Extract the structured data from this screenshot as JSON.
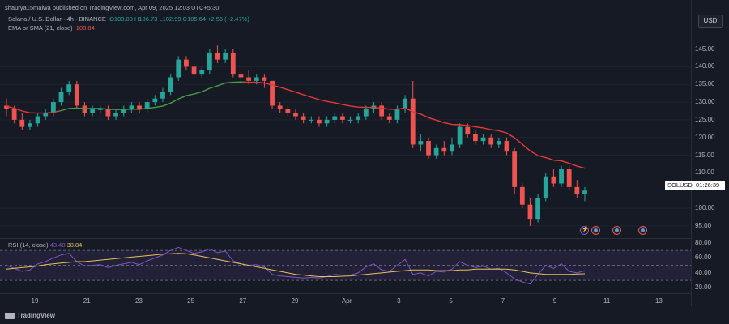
{
  "header": {
    "published": "shaurya15malwa published on TradingView.com, Apr 09, 2025 12:03 UTC+5:30",
    "currency_button": "USD"
  },
  "legend": {
    "symbol": "Solana / U.S. Dollar · 4h · BINANCE",
    "o_label": "O",
    "o": "103.08",
    "h_label": "H",
    "h": "106.73",
    "l_label": "L",
    "l": "102.99",
    "c_label": "C",
    "c": "105.64",
    "change": "+2.55 (+2.47%)",
    "ema_label": "EMA or SMA (21, close)",
    "ema_value": "108.84"
  },
  "rsi": {
    "label": "RSI (14, close)",
    "value": "43.48",
    "sma_value": "38.84",
    "levels": [
      30,
      50,
      70
    ]
  },
  "current_price_tag": {
    "symbol": "SOLUSD",
    "countdown": "01:26:39",
    "price": 106.5
  },
  "price_axis": {
    "ticks": [
      "145.00",
      "140.00",
      "135.00",
      "130.00",
      "125.00",
      "120.00",
      "115.00",
      "110.00",
      "100.00",
      "95.00"
    ],
    "tick_values": [
      145,
      140,
      135,
      130,
      125,
      120,
      115,
      110,
      100,
      95
    ],
    "min": 92,
    "max": 152
  },
  "rsi_axis": {
    "ticks": [
      "80.00",
      "60.00",
      "40.00",
      "20.00"
    ],
    "tick_values": [
      80,
      60,
      40,
      20
    ],
    "min": 15,
    "max": 82
  },
  "time_axis": {
    "labels": [
      "19",
      "21",
      "23",
      "25",
      "27",
      "29",
      "Apr",
      "3",
      "5",
      "7",
      "9",
      "11",
      "13"
    ]
  },
  "logo": {
    "text": "TradingView"
  },
  "colors": {
    "up": "#26a69a",
    "down": "#ef5350",
    "ema_green": "#43a047",
    "ema_red": "#e53935",
    "rsi": "#7e57c2",
    "rsi_ma": "#e8c15a"
  },
  "chart_data": {
    "type": "candlestick",
    "symbol": "SOLUSD",
    "interval": "4h",
    "candles_ohlc": [
      [
        129,
        131,
        126,
        128
      ],
      [
        128,
        129,
        124,
        125
      ],
      [
        125,
        127,
        122,
        123
      ],
      [
        123,
        125,
        122,
        124
      ],
      [
        124,
        127,
        123,
        126
      ],
      [
        126,
        128,
        125,
        127
      ],
      [
        127,
        131,
        126,
        130
      ],
      [
        130,
        134,
        129,
        133
      ],
      [
        133,
        136,
        132,
        135
      ],
      [
        135,
        136,
        128,
        129
      ],
      [
        129,
        130,
        126,
        127
      ],
      [
        127,
        129,
        126,
        128
      ],
      [
        128,
        129,
        127,
        128
      ],
      [
        128,
        129,
        125,
        126
      ],
      [
        126,
        128,
        125,
        127
      ],
      [
        127,
        129,
        126,
        128
      ],
      [
        128,
        130,
        127,
        129
      ],
      [
        129,
        130,
        127,
        128
      ],
      [
        128,
        131,
        127,
        130
      ],
      [
        130,
        132,
        129,
        131
      ],
      [
        131,
        134,
        130,
        133
      ],
      [
        133,
        138,
        132,
        137
      ],
      [
        137,
        143,
        136,
        142
      ],
      [
        142,
        143,
        139,
        140
      ],
      [
        140,
        141,
        137,
        138
      ],
      [
        138,
        140,
        137,
        139
      ],
      [
        139,
        145,
        138,
        144
      ],
      [
        144,
        146,
        141,
        142
      ],
      [
        142,
        145,
        141,
        144
      ],
      [
        144,
        145,
        137,
        138
      ],
      [
        138,
        139,
        136,
        137
      ],
      [
        137,
        139,
        135,
        136
      ],
      [
        136,
        138,
        135,
        137
      ],
      [
        137,
        138,
        134,
        136
      ],
      [
        136,
        134,
        128,
        129
      ],
      [
        129,
        130,
        127,
        128
      ],
      [
        128,
        129,
        126,
        127
      ],
      [
        127,
        128,
        125,
        126
      ],
      [
        126,
        127,
        124,
        125
      ],
      [
        125,
        126,
        124,
        125
      ],
      [
        125,
        126,
        123,
        124
      ],
      [
        124,
        126,
        123,
        125
      ],
      [
        125,
        127,
        124,
        126
      ],
      [
        126,
        127,
        124,
        125
      ],
      [
        125,
        126,
        124,
        125
      ],
      [
        125,
        127,
        124,
        126
      ],
      [
        126,
        129,
        125,
        128
      ],
      [
        128,
        130,
        127,
        129
      ],
      [
        129,
        130,
        125,
        126
      ],
      [
        126,
        127,
        124,
        125
      ],
      [
        125,
        129,
        124,
        128
      ],
      [
        128,
        132,
        127,
        131
      ],
      [
        131,
        136,
        117,
        118
      ],
      [
        118,
        121,
        116,
        119
      ],
      [
        119,
        120,
        114,
        115
      ],
      [
        115,
        118,
        114,
        117
      ],
      [
        117,
        119,
        115,
        116
      ],
      [
        116,
        120,
        115,
        118
      ],
      [
        118,
        124,
        117,
        123
      ],
      [
        123,
        124,
        120,
        121
      ],
      [
        121,
        122,
        118,
        119
      ],
      [
        119,
        121,
        118,
        120
      ],
      [
        120,
        121,
        117,
        118
      ],
      [
        118,
        120,
        117,
        119
      ],
      [
        119,
        120,
        115,
        116
      ],
      [
        116,
        117,
        104,
        106
      ],
      [
        106,
        107,
        100,
        101
      ],
      [
        101,
        103,
        95,
        97
      ],
      [
        97,
        104,
        96,
        103
      ],
      [
        103,
        110,
        102,
        109
      ],
      [
        109,
        111,
        106,
        107
      ],
      [
        107,
        112,
        106,
        111
      ],
      [
        111,
        112,
        105,
        106
      ],
      [
        106,
        108,
        103,
        104
      ],
      [
        104,
        106,
        102,
        105
      ]
    ],
    "ema": [
      128.8,
      128.3,
      127.5,
      127.0,
      126.9,
      126.9,
      127.1,
      127.6,
      128.2,
      128.3,
      128.2,
      128.2,
      128.2,
      128.0,
      127.9,
      127.9,
      128.0,
      128.0,
      128.2,
      128.5,
      128.9,
      129.7,
      130.9,
      131.8,
      132.3,
      132.9,
      133.9,
      134.6,
      135.4,
      135.6,
      135.7,
      135.6,
      135.6,
      135.4,
      134.8,
      134.2,
      133.5,
      132.8,
      132.1,
      131.4,
      130.7,
      130.2,
      129.8,
      129.3,
      128.9,
      128.6,
      128.5,
      128.5,
      128.3,
      128.0,
      128.0,
      128.3,
      127.3,
      126.6,
      125.6,
      124.9,
      124.2,
      123.7,
      123.6,
      123.4,
      123.0,
      122.7,
      122.2,
      121.9,
      121.3,
      119.9,
      118.1,
      116.2,
      114.9,
      114.3,
      113.6,
      113.4,
      112.7,
      111.9,
      111.3
    ],
    "rsi": [
      50,
      46,
      42,
      44,
      52,
      55,
      60,
      64,
      66,
      55,
      49,
      50,
      51,
      47,
      50,
      52,
      54,
      51,
      56,
      60,
      64,
      70,
      74,
      70,
      66,
      68,
      72,
      67,
      69,
      56,
      52,
      50,
      51,
      48,
      38,
      36,
      35,
      34,
      33,
      34,
      33,
      35,
      38,
      37,
      37,
      40,
      48,
      52,
      44,
      42,
      50,
      58,
      38,
      40,
      36,
      42,
      41,
      45,
      55,
      50,
      47,
      49,
      45,
      46,
      40,
      32,
      28,
      25,
      38,
      50,
      46,
      52,
      42,
      40,
      43
    ],
    "rsi_ma": [
      45,
      46,
      47,
      48,
      49,
      51,
      52,
      53,
      54,
      55,
      55,
      56,
      57,
      58,
      59,
      60,
      61,
      62,
      63,
      64,
      65,
      65.5,
      66,
      65.5,
      64,
      62,
      60,
      58,
      56,
      54,
      52,
      50,
      48,
      46,
      44,
      42,
      40,
      38,
      37,
      36,
      35,
      35,
      35,
      35.5,
      36,
      37,
      38,
      39,
      40,
      41,
      42,
      43,
      44,
      44,
      44,
      43,
      43,
      43,
      44,
      44,
      45,
      45,
      45,
      45,
      45,
      44,
      42,
      40,
      39,
      38,
      38,
      38,
      38,
      38.5,
      38.8
    ],
    "price_range": [
      92,
      152
    ],
    "rsi_range": [
      15,
      82
    ]
  }
}
